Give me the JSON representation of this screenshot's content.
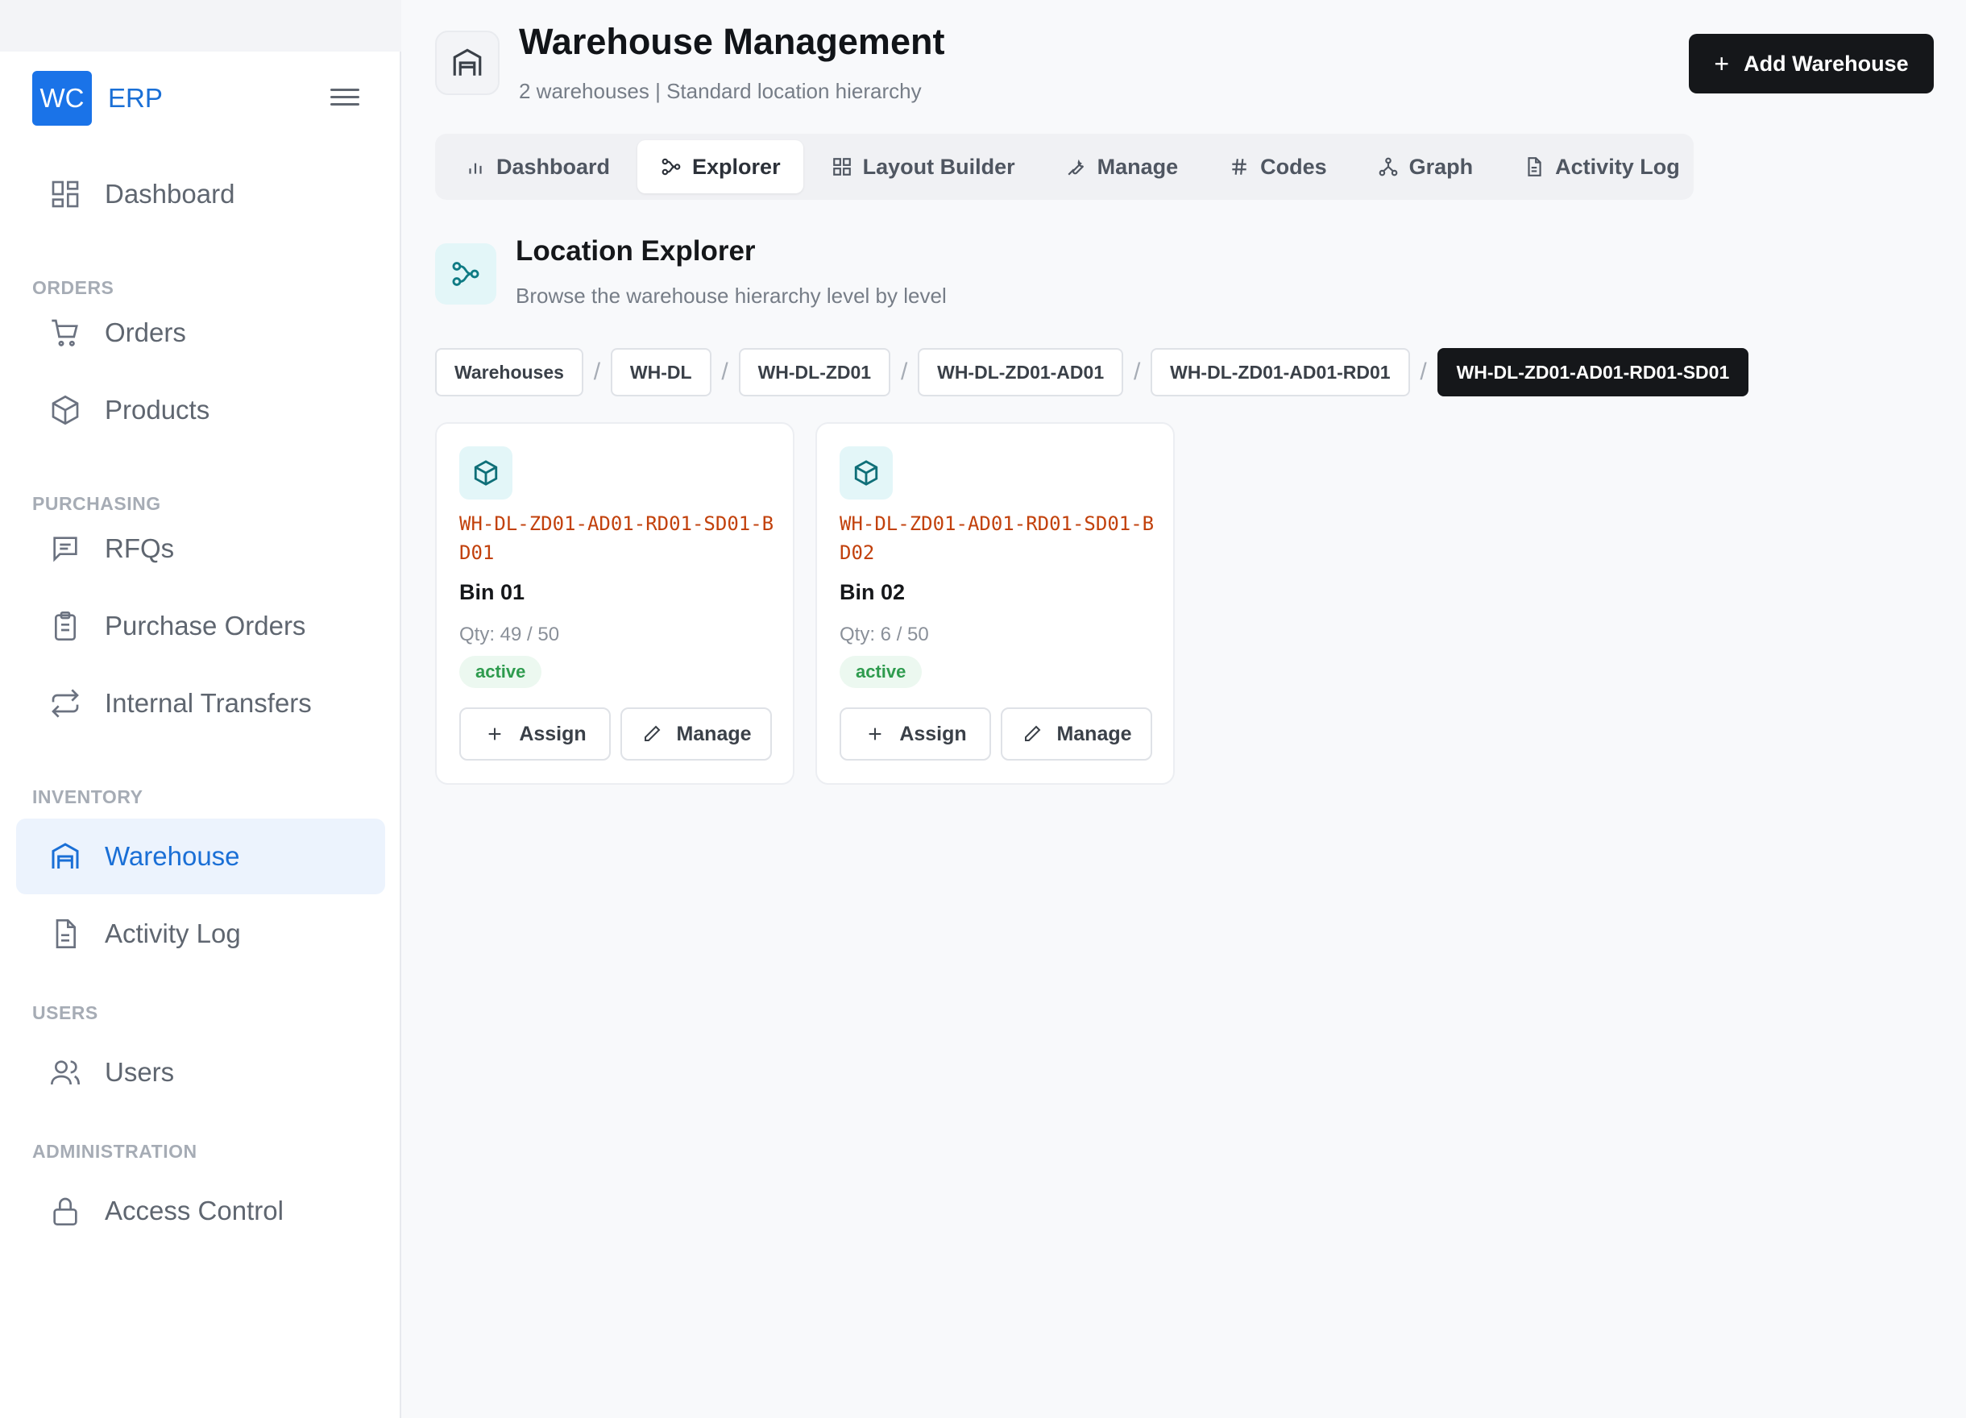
{
  "brand": {
    "logo": "WC",
    "name": "ERP"
  },
  "sidebar": {
    "sections": [
      "ORDERS",
      "PURCHASING",
      "INVENTORY",
      "USERS",
      "ADMINISTRATION"
    ],
    "items": [
      {
        "label": "Dashboard",
        "icon": "dashboard-icon"
      },
      {
        "label": "Orders",
        "icon": "cart-icon"
      },
      {
        "label": "Products",
        "icon": "box-icon"
      },
      {
        "label": "RFQs",
        "icon": "message-icon"
      },
      {
        "label": "Purchase Orders",
        "icon": "clipboard-icon"
      },
      {
        "label": "Internal Transfers",
        "icon": "transfer-icon"
      },
      {
        "label": "Warehouse",
        "icon": "warehouse-icon",
        "active": true
      },
      {
        "label": "Activity Log",
        "icon": "document-icon"
      },
      {
        "label": "Users",
        "icon": "users-icon"
      },
      {
        "label": "Access Control",
        "icon": "lock-icon"
      }
    ]
  },
  "header": {
    "title": "Warehouse Management",
    "subtitle": "2 warehouses | Standard location hierarchy",
    "add_button": "Add Warehouse"
  },
  "tabs": [
    {
      "label": "Dashboard",
      "icon": "bar-chart-icon"
    },
    {
      "label": "Explorer",
      "icon": "hierarchy-icon",
      "active": true
    },
    {
      "label": "Layout Builder",
      "icon": "grid-icon"
    },
    {
      "label": "Manage",
      "icon": "wrench-icon"
    },
    {
      "label": "Codes",
      "icon": "hash-icon"
    },
    {
      "label": "Graph",
      "icon": "graph-icon"
    },
    {
      "label": "Activity Log",
      "icon": "document-icon"
    }
  ],
  "explorer": {
    "title": "Location Explorer",
    "subtitle": "Browse the warehouse hierarchy level by level",
    "breadcrumbs": [
      "Warehouses",
      "WH-DL",
      "WH-DL-ZD01",
      "WH-DL-ZD01-AD01",
      "WH-DL-ZD01-AD01-RD01",
      "WH-DL-ZD01-AD01-RD01-SD01"
    ],
    "separator": "/",
    "bins": [
      {
        "code": "WH-DL-ZD01-AD01-RD01-SD01-BD01",
        "name": "Bin 01",
        "qty": "Qty: 49 / 50",
        "status": "active",
        "assign": "Assign",
        "manage": "Manage"
      },
      {
        "code": "WH-DL-ZD01-AD01-RD01-SD01-BD02",
        "name": "Bin 02",
        "qty": "Qty: 6 / 50",
        "status": "active",
        "assign": "Assign",
        "manage": "Manage"
      }
    ]
  },
  "colors": {
    "accent": "#1a73e8",
    "primary_button": "#15171a",
    "code_text": "#c2410c",
    "status_active": "#2e9b4e"
  }
}
